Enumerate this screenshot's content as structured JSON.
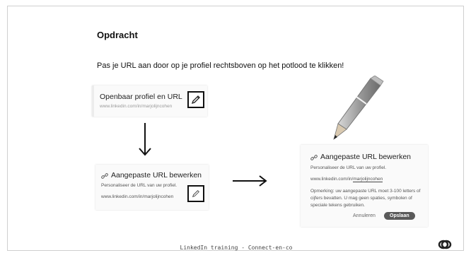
{
  "slide": {
    "title": "Opdracht",
    "instruction": "Pas je URL aan door op je profiel rechtsboven op het potlood te klikken!",
    "footer": "LinkedIn training - Connect-en-co"
  },
  "card_profile": {
    "heading": "Openbaar profiel en URL",
    "url": "www.linkedin.com/in/marjolijncohen"
  },
  "card_custom_url_small": {
    "heading": "Aangepaste URL bewerken",
    "subtitle": "Personaliseer de URL van uw profiel.",
    "url": "www.linkedin.com/in/marjolijncohen"
  },
  "card_custom_url_dialog": {
    "heading": "Aangepaste URL bewerken",
    "subtitle": "Personaliseer de URL van uw profiel.",
    "url_prefix": "www.linkedin.com/in/",
    "url_value": "marjolijncohen",
    "note": "Opmerking: uw aangepaste URL moet 3-100 letters of cijfers bevatten. U mag geen spaties, symbolen of speciale tekens gebruiken.",
    "cancel_label": "Annuleren",
    "save_label": "Opslaan"
  },
  "icons": [
    "pencil-icon",
    "link-icon",
    "arrow-down-icon",
    "arrow-right-icon",
    "pencil-illustration",
    "brand-logo-icon"
  ]
}
